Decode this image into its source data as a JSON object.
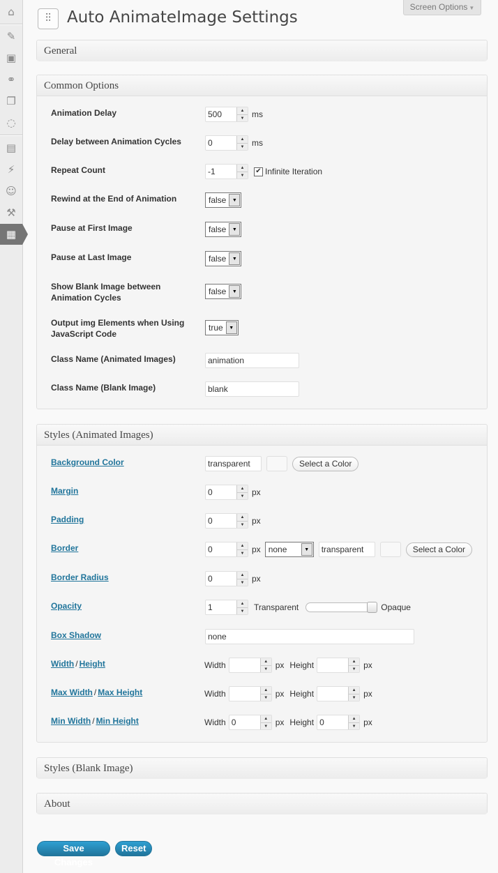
{
  "screen_options": {
    "label": "Screen Options"
  },
  "page": {
    "title": "Auto AnimateImage Settings"
  },
  "sidebar": {
    "icons": [
      "dashboard-icon",
      "pin-icon",
      "media-icon",
      "links-icon",
      "pages-icon",
      "comments-icon",
      "appearance-icon",
      "plugins-icon",
      "users-icon",
      "tools-icon",
      "settings-icon"
    ]
  },
  "sections": {
    "general": "General",
    "common": "Common Options",
    "styles_animated": "Styles (Animated Images)",
    "styles_blank": "Styles (Blank Image)",
    "about": "About"
  },
  "common": {
    "animation_delay": {
      "label": "Animation Delay",
      "value": "500",
      "unit": "ms"
    },
    "cycle_delay": {
      "label": "Delay between Animation Cycles",
      "value": "0",
      "unit": "ms"
    },
    "repeat_count": {
      "label": "Repeat Count",
      "value": "-1",
      "infinite_label": "Infinite Iteration",
      "infinite_checked": true
    },
    "rewind": {
      "label": "Rewind at the End of Animation",
      "value": "false"
    },
    "pause_first": {
      "label": "Pause at First Image",
      "value": "false"
    },
    "pause_last": {
      "label": "Pause at Last Image",
      "value": "false"
    },
    "show_blank": {
      "label_1": "Show Blank Image between",
      "label_2": "Animation Cycles",
      "value": "false"
    },
    "output_img": {
      "label_1": "Output img Elements when Using",
      "label_2": "JavaScript Code",
      "value": "true"
    },
    "class_animated": {
      "label": "Class Name (Animated Images)",
      "value": "animation"
    },
    "class_blank": {
      "label": "Class Name (Blank Image)",
      "value": "blank"
    }
  },
  "styles": {
    "background_color": {
      "label": "Background Color",
      "value": "transparent",
      "button": "Select a Color"
    },
    "margin": {
      "label": "Margin",
      "value": "0",
      "unit": "px"
    },
    "padding": {
      "label": "Padding",
      "value": "0",
      "unit": "px"
    },
    "border": {
      "label": "Border",
      "value": "0",
      "unit": "px",
      "style": "none",
      "color": "transparent",
      "button": "Select a Color"
    },
    "border_radius": {
      "label": "Border Radius",
      "value": "0",
      "unit": "px"
    },
    "opacity": {
      "label": "Opacity",
      "value": "1",
      "left": "Transparent",
      "right": "Opaque",
      "level": 1.0
    },
    "box_shadow": {
      "label": "Box Shadow",
      "value": "none"
    },
    "size": {
      "label_w": "Width",
      "label_h": "Height",
      "width_label": "Width",
      "height_label": "Height",
      "width": "",
      "height": "",
      "unit": "px"
    },
    "max_size": {
      "label_w": "Max Width",
      "label_h": "Max Height",
      "width_label": "Width",
      "height_label": "Height",
      "width": "",
      "height": "",
      "unit": "px"
    },
    "min_size": {
      "label_w": "Min Width",
      "label_h": "Min Height",
      "width_label": "Width",
      "height_label": "Height",
      "width": "0",
      "height": "0",
      "unit": "px"
    },
    "separator": "/"
  },
  "buttons": {
    "save": "Save Changes",
    "reset": "Reset"
  }
}
